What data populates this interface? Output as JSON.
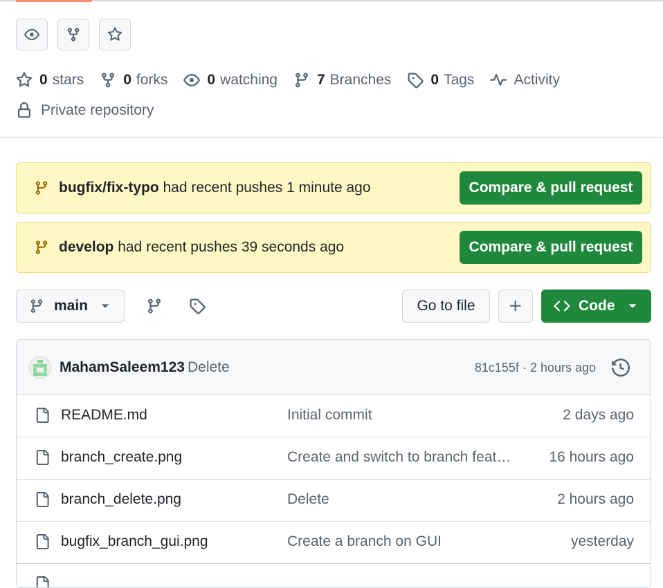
{
  "repo_actions": {
    "watch_icon": "eye-icon",
    "fork_icon": "repo-forked-icon",
    "star_icon": "star-icon"
  },
  "stats": {
    "stars_count": "0",
    "stars_label": "stars",
    "forks_count": "0",
    "forks_label": "forks",
    "watching_count": "0",
    "watching_label": "watching",
    "branches_count": "7",
    "branches_label": "Branches",
    "tags_count": "0",
    "tags_label": "Tags",
    "activity_label": "Activity"
  },
  "visibility": "Private repository",
  "banners": [
    {
      "branch": "bugfix/fix-typo",
      "text": "had recent pushes 1 minute ago",
      "button": "Compare & pull request"
    },
    {
      "branch": "develop",
      "text": "had recent pushes 39 seconds ago",
      "button": "Compare & pull request"
    }
  ],
  "toolbar": {
    "branch": "main",
    "go_to_file": "Go to file",
    "code": "Code"
  },
  "latest_commit": {
    "user": "MahamSaleem123",
    "message": "Delete",
    "info": "81c155f · 2 hours ago"
  },
  "files": [
    {
      "name": "README.md",
      "message": "Initial commit",
      "time": "2 days ago"
    },
    {
      "name": "branch_create.png",
      "message": "Create and switch to branch feat…",
      "time": "16 hours ago"
    },
    {
      "name": "branch_delete.png",
      "message": "Delete",
      "time": "2 hours ago"
    },
    {
      "name": "bugfix_branch_gui.png",
      "message": "Create a branch on GUI",
      "time": "yesterday"
    }
  ],
  "colors": {
    "primary_green": "#1f883d",
    "banner_bg": "#fff8c5",
    "banner_icon": "#9a6700",
    "muted_text": "#59636e",
    "border": "#d0d7de"
  }
}
